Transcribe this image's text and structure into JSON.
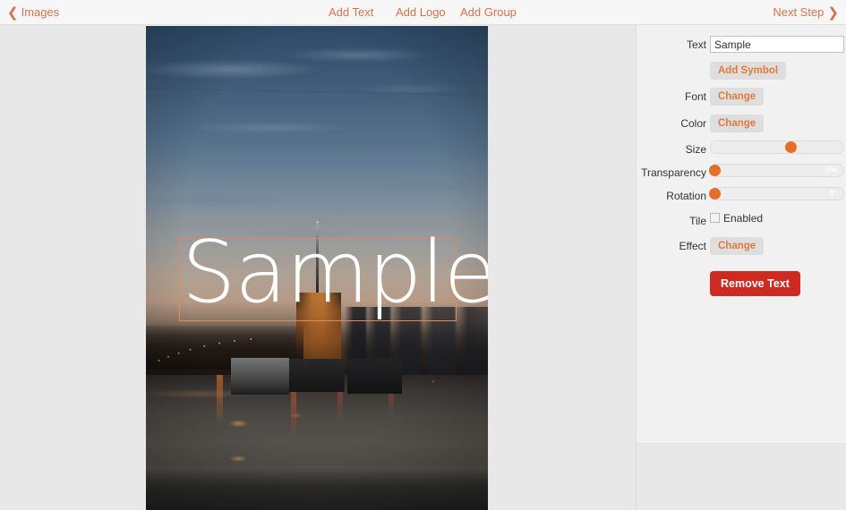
{
  "topbar": {
    "back_label": "Images",
    "back_chevron": "chevron-left-icon",
    "add_text": "Add Text",
    "add_logo": "Add Logo",
    "add_group": "Add Group",
    "next_label": "Next Step",
    "next_chevron": "chevron-right-icon",
    "accent_color": "#d9714b"
  },
  "canvas": {
    "overlay_text": "Sample",
    "overlay_text_color": "#ffffff",
    "selection_border_color": "#e08a5a"
  },
  "panel": {
    "rows": {
      "text": {
        "label": "Text",
        "value": "Sample",
        "placeholder": ""
      },
      "add_symbol": {
        "label": "Add Symbol"
      },
      "font": {
        "label": "Font",
        "button": "Change"
      },
      "color": {
        "label": "Color",
        "button": "Change"
      },
      "size": {
        "label": "Size",
        "value": "",
        "handle_percent": 60
      },
      "transparency": {
        "label": "Transparency",
        "value": "0%",
        "handle_percent": 3
      },
      "rotation": {
        "label": "Rotation",
        "value": "0°",
        "handle_percent": 3
      },
      "tile": {
        "label": "Tile",
        "checkbox_label": "Enabled",
        "checked": false
      },
      "effect": {
        "label": "Effect",
        "button": "Change"
      },
      "remove": {
        "label": "Remove Text"
      }
    },
    "colors": {
      "button_bg": "#dedede",
      "button_text": "#e07b3c",
      "slider_handle": "#e2702a",
      "danger_bg": "#cd2a22",
      "danger_text": "#ffffff"
    }
  }
}
